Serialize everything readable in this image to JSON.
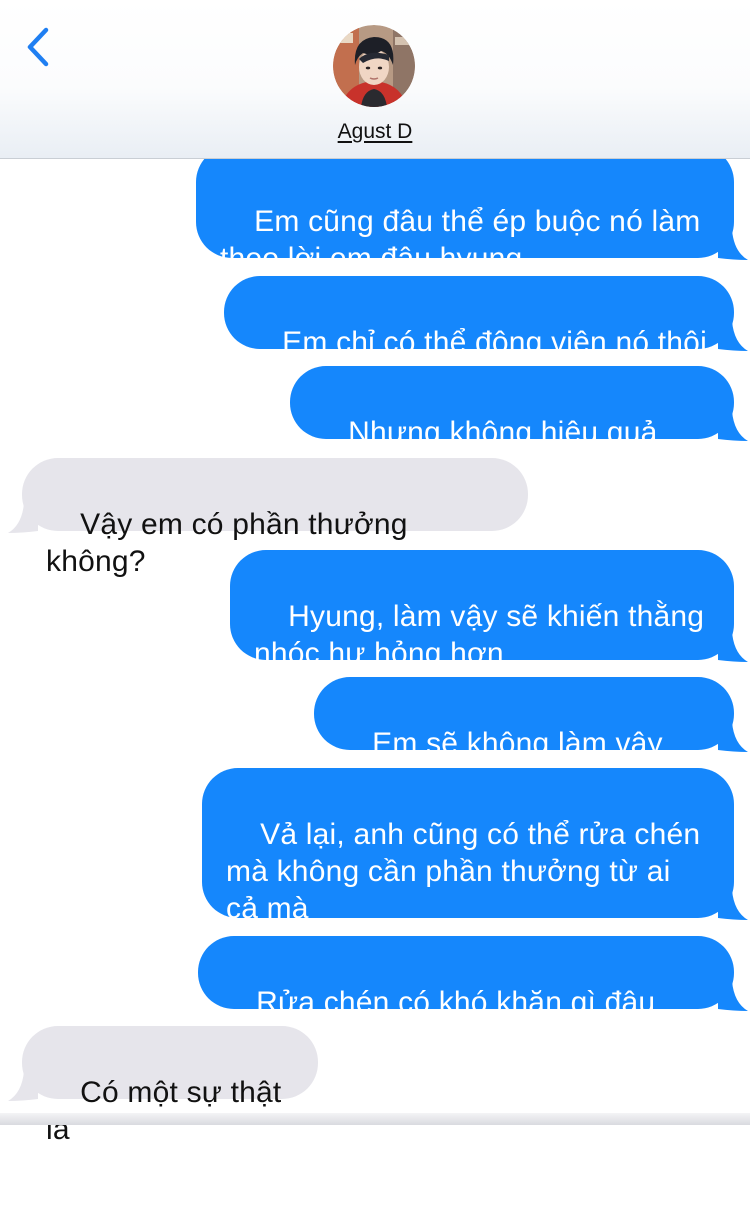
{
  "contact": {
    "name": "Agust D"
  },
  "colors": {
    "outgoing_bubble": "#1587fc",
    "incoming_bubble": "#e6e5eb",
    "back_chevron": "#1f7ff2"
  },
  "icons": {
    "back": "chevron-left-icon",
    "avatar": "contact-avatar"
  },
  "messages": [
    {
      "direction": "outgoing",
      "text": "Em cũng đâu thể ép buộc nó làm\ntheo lời em đâu hyung"
    },
    {
      "direction": "outgoing",
      "text": "Em chỉ có thể động viên nó thôi"
    },
    {
      "direction": "outgoing",
      "text": "Nhưng không hiệu quả lắm"
    },
    {
      "direction": "incoming",
      "text": "Vậy em có phần thưởng không?"
    },
    {
      "direction": "outgoing",
      "text": "Hyung, làm vậy sẽ khiến thằng\nnhóc hư hỏng hơn"
    },
    {
      "direction": "outgoing",
      "text": "Em sẽ không làm vậy đâu"
    },
    {
      "direction": "outgoing",
      "text": "Vả lại, anh cũng có thể rửa chén\nmà không cần phần thưởng từ ai\ncả mà"
    },
    {
      "direction": "outgoing",
      "text": "Rửa chén có khó khăn gì đâu chứ"
    },
    {
      "direction": "incoming",
      "text": "Có một sự thật là"
    }
  ]
}
